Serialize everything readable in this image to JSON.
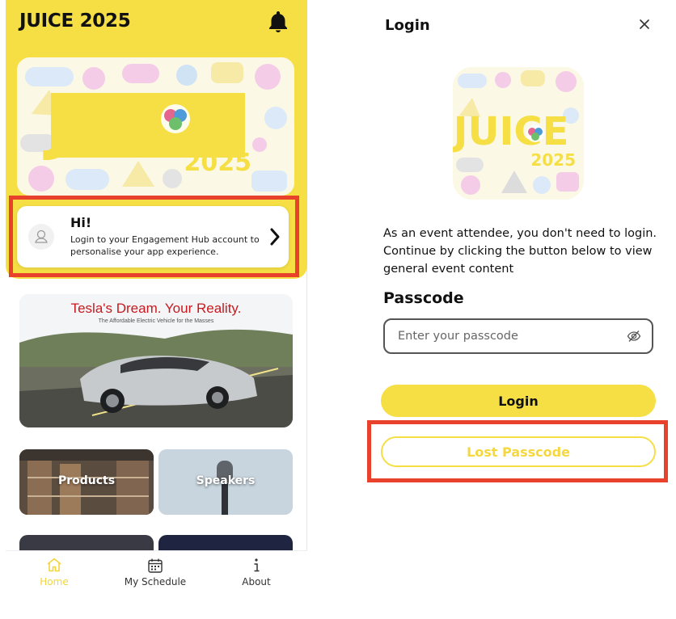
{
  "left_app": {
    "title": "JUICE 2025",
    "banner": {
      "word": "JUICE",
      "year": "2025"
    },
    "hi_card": {
      "heading": "Hi!",
      "text": "Login to your Engagement Hub account to personalise your app experience."
    },
    "promo": {
      "headline": "Tesla's Dream. Your Reality.",
      "subline": "The Affordable Electric Vehicle for the Masses"
    },
    "tiles": [
      {
        "label": "Products"
      },
      {
        "label": "Speakers"
      }
    ],
    "tabs": [
      {
        "label": "Home",
        "icon": "home-icon",
        "active": true
      },
      {
        "label": "My Schedule",
        "icon": "calendar-icon",
        "active": false
      },
      {
        "label": "About",
        "icon": "info-icon",
        "active": false
      }
    ]
  },
  "login_modal": {
    "title": "Login",
    "logo": {
      "word": "JUICE",
      "year": "2025"
    },
    "description": "As an event attendee, you don't need to login. Continue by clicking the button below to view general event content",
    "passcode_label": "Passcode",
    "passcode_placeholder": "Enter your passcode",
    "login_button": "Login",
    "lost_button": "Lost Passcode"
  },
  "colors": {
    "brand_yellow": "#f5df45",
    "highlight_red": "#e8412c"
  }
}
